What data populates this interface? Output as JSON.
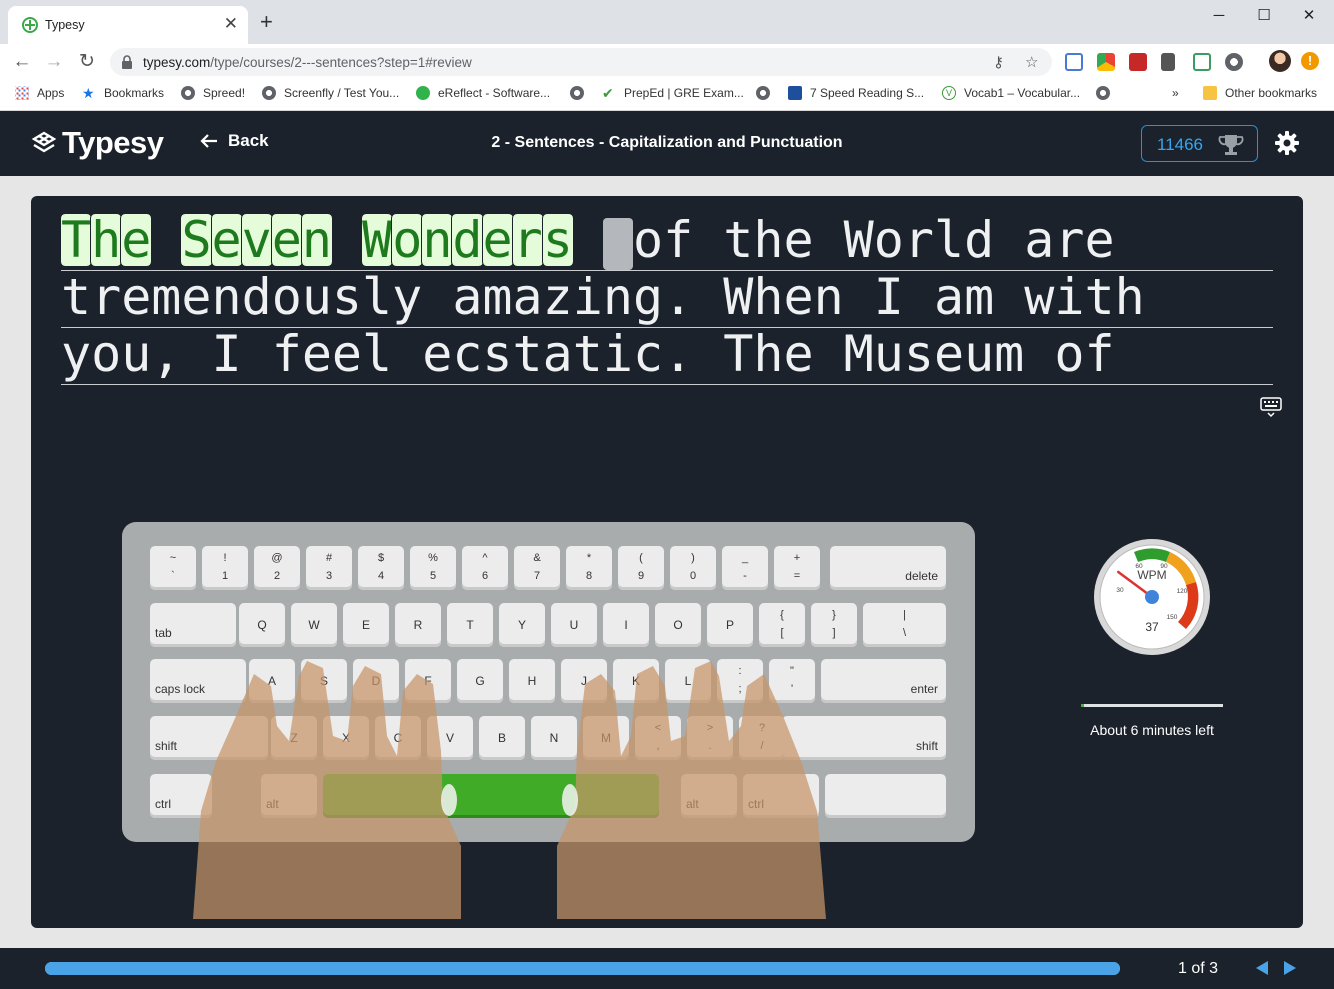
{
  "browser": {
    "tab_title": "Typesy",
    "url_domain": "typesy.com",
    "url_path": "/type/courses/2---sentences?step=1#review",
    "bookmarks": [
      {
        "label": "Apps"
      },
      {
        "label": "Bookmarks"
      },
      {
        "label": "Spreed!"
      },
      {
        "label": "Screenfly / Test You..."
      },
      {
        "label": "eReflect - Software..."
      },
      {
        "label": ""
      },
      {
        "label": "PrepEd | GRE Exam..."
      },
      {
        "label": ""
      },
      {
        "label": "7 Speed Reading S..."
      },
      {
        "label": "Vocab1 – Vocabular..."
      },
      {
        "label": ""
      }
    ],
    "other_bookmarks": "Other bookmarks",
    "overflow": "»"
  },
  "app": {
    "logo_text": "Typesy",
    "back_label": "Back",
    "lesson_title": "2 - Sentences - Capitalization and Punctuation",
    "score": "11466"
  },
  "typing": {
    "typed_words": [
      "The",
      "Seven",
      "Wonders"
    ],
    "line1_rest": "of the World are",
    "line2": "tremendously amazing. When I am with",
    "line3": "you, I feel ecstatic. The Museum of"
  },
  "keyboard": {
    "row1": [
      [
        "~",
        "`"
      ],
      [
        "!",
        "1"
      ],
      [
        "@",
        "2"
      ],
      [
        "#",
        "3"
      ],
      [
        "$",
        "4"
      ],
      [
        "%",
        "5"
      ],
      [
        "^",
        "6"
      ],
      [
        "&",
        "7"
      ],
      [
        "*",
        "8"
      ],
      [
        "(",
        "9"
      ],
      [
        ")",
        "0"
      ],
      [
        "_",
        "-"
      ],
      [
        "+",
        "="
      ]
    ],
    "delete": "delete",
    "tab": "tab",
    "row2": [
      "Q",
      "W",
      "E",
      "R",
      "T",
      "Y",
      "U",
      "I",
      "O",
      "P"
    ],
    "row2_brackets": [
      [
        "{",
        "["
      ],
      [
        "}",
        "]"
      ],
      [
        "|",
        "\\"
      ]
    ],
    "caps": "caps lock",
    "row3": [
      "A",
      "S",
      "D",
      "F",
      "G",
      "H",
      "J",
      "K",
      "L"
    ],
    "row3_punct": [
      [
        ":",
        ";"
      ],
      [
        "\"",
        "'"
      ]
    ],
    "enter": "enter",
    "shift": "shift",
    "row4": [
      "Z",
      "X",
      "C",
      "V",
      "B",
      "N",
      "M"
    ],
    "row4_punct": [
      [
        "<",
        ","
      ],
      [
        ">",
        "."
      ],
      [
        "?",
        "/"
      ]
    ],
    "ctrl": "ctrl",
    "alt": "alt"
  },
  "speed": {
    "label": "WPM",
    "value": "37",
    "ticks": [
      "30",
      "60",
      "90",
      "120",
      "150"
    ],
    "time_left": "About 6 minutes left",
    "time_progress": 0.02
  },
  "footer": {
    "progress": 1.0,
    "page_text": "1 of 3"
  },
  "colors": {
    "accent": "#35a6f0",
    "typed_bg": "#e4fcd9",
    "typed_fg": "#1d7a1d",
    "space_key": "#3fab26",
    "panel": "#1b222b"
  }
}
